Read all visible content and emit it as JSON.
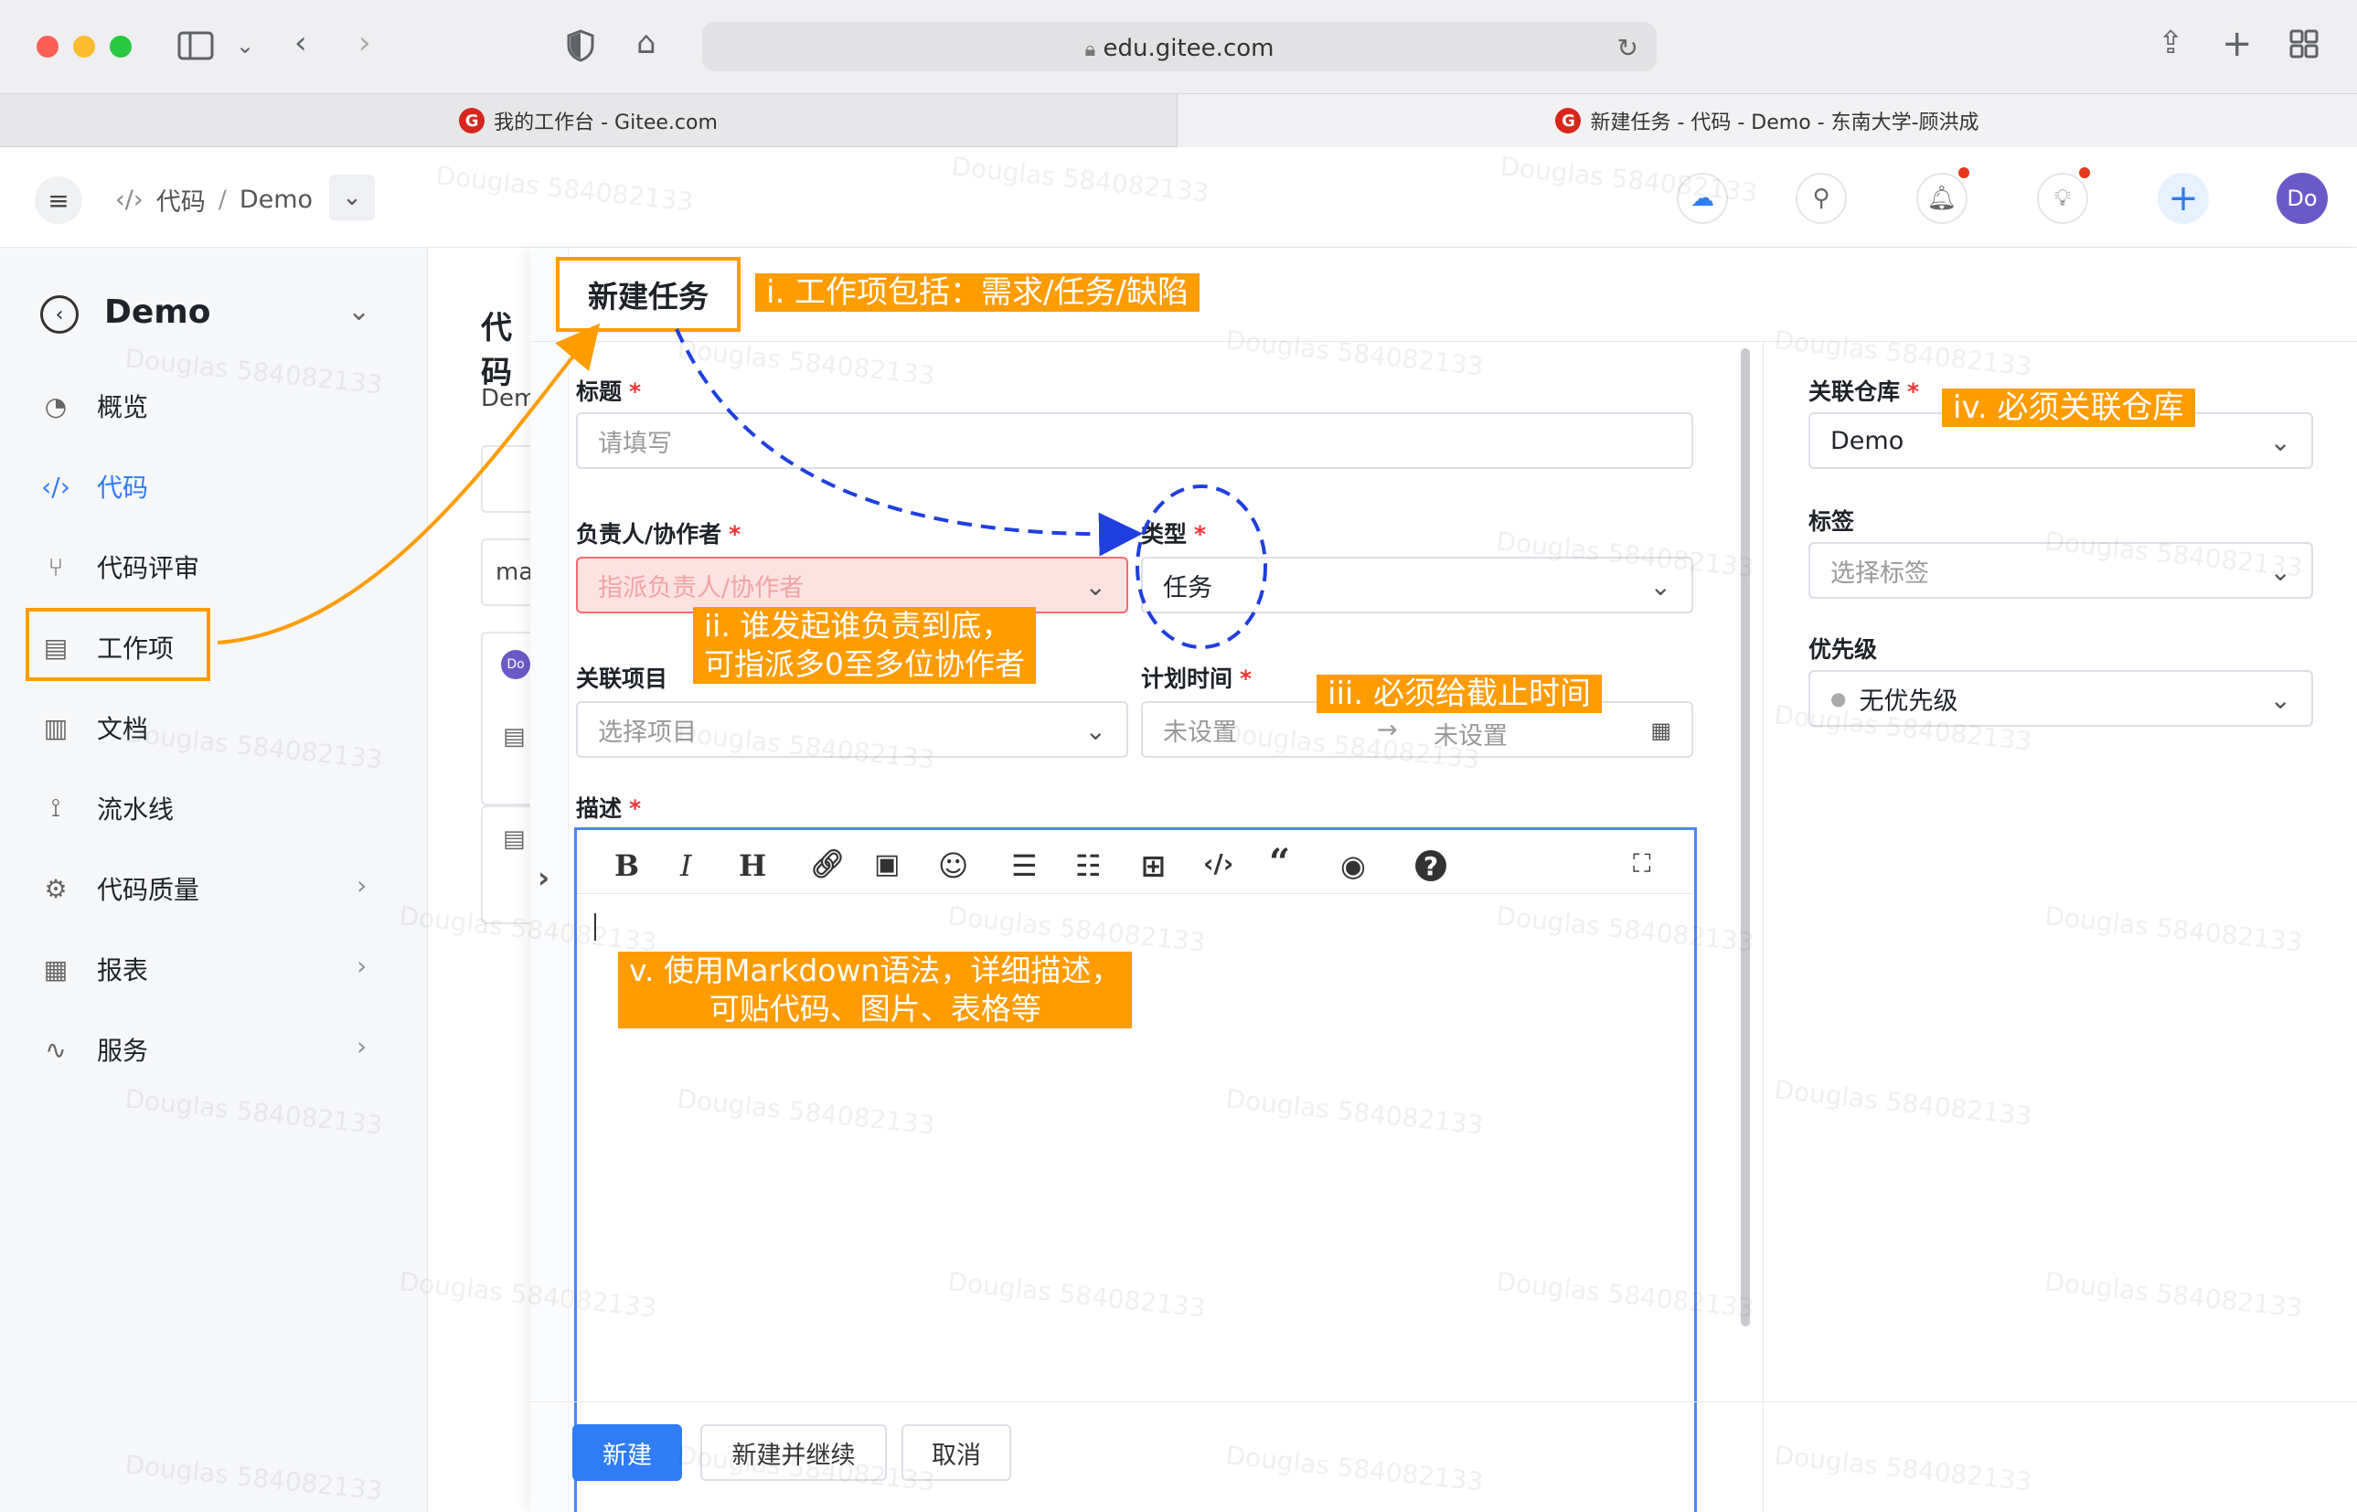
{
  "browser": {
    "url": "edu.gitee.com",
    "tabs": [
      {
        "label": "我的工作台 - Gitee.com"
      },
      {
        "label": "新建任务 - 代码 - Demo - 东南大学-顾洪成"
      }
    ]
  },
  "header": {
    "breadcrumb_code": "代码",
    "breadcrumb_sep": "/",
    "breadcrumb_repo": "Demo",
    "avatar": "Do"
  },
  "sidebar": {
    "title": "Demo",
    "items": [
      {
        "label": "概览"
      },
      {
        "label": "代码"
      },
      {
        "label": "代码评审"
      },
      {
        "label": "工作项"
      },
      {
        "label": "文档"
      },
      {
        "label": "流水线"
      },
      {
        "label": "代码质量"
      },
      {
        "label": "报表"
      },
      {
        "label": "服务"
      }
    ]
  },
  "background_page": {
    "title_partial": "代码",
    "repo_partial": "Dem",
    "branch_partial": "ma",
    "avatar_partial": "Do"
  },
  "modal": {
    "title": "新建任务",
    "title_field": {
      "label": "标题",
      "placeholder": "请填写"
    },
    "assignee": {
      "label": "负责人/协作者",
      "placeholder": "指派负责人/协作者"
    },
    "type": {
      "label": "类型",
      "value": "任务"
    },
    "project": {
      "label": "关联项目",
      "placeholder": "选择项目"
    },
    "plan_time": {
      "label": "计划时间",
      "start": "未设置",
      "arrow": "→",
      "end": "未设置"
    },
    "description": {
      "label": "描述"
    },
    "repo": {
      "label": "关联仓库",
      "value": "Demo"
    },
    "tags": {
      "label": "标签",
      "placeholder": "选择标签"
    },
    "priority": {
      "label": "优先级",
      "value": "无优先级"
    },
    "buttons": {
      "create": "新建",
      "create_continue": "新建并继续",
      "cancel": "取消"
    }
  },
  "annotations": {
    "i": "i. 工作项包括：需求/任务/缺陷",
    "ii_1": "ii. 谁发起谁负责到底，",
    "ii_2": "可指派多0至多位协作者",
    "iii": "iii. 必须给截止时间",
    "iv": "iv. 必须关联仓库",
    "v_1": "v. 使用Markdown语法，详细描述，",
    "v_2": "可贴代码、图片、表格等"
  },
  "watermark": "Douglas 584082133",
  "colors": {
    "accent": "#2f7cf6",
    "annotation": "#ff9c00",
    "error": "#f56c6c",
    "arrow_blue": "#1f3fe0"
  }
}
